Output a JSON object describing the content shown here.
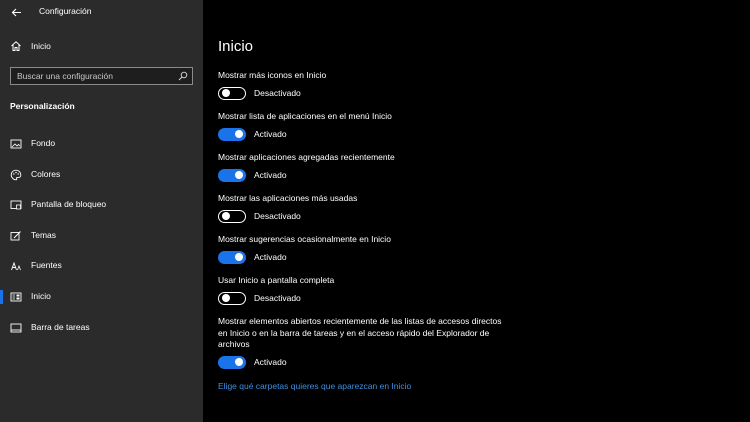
{
  "window": {
    "title": "Configuración"
  },
  "sidebar": {
    "home_label": "Inicio",
    "search": {
      "placeholder": "Buscar una configuración"
    },
    "section_title": "Personalización",
    "items": [
      {
        "label": "Fondo",
        "icon": "image-icon"
      },
      {
        "label": "Colores",
        "icon": "palette-icon"
      },
      {
        "label": "Pantalla de bloqueo",
        "icon": "lock-screen-icon"
      },
      {
        "label": "Temas",
        "icon": "brush-icon"
      },
      {
        "label": "Fuentes",
        "icon": "font-icon"
      },
      {
        "label": "Inicio",
        "icon": "start-menu-icon",
        "selected": true
      },
      {
        "label": "Barra de tareas",
        "icon": "taskbar-icon"
      }
    ]
  },
  "main": {
    "title": "Inicio",
    "settings": [
      {
        "label": "Mostrar más iconos en Inicio",
        "state": "Desactivado",
        "on": false
      },
      {
        "label": "Mostrar lista de aplicaciones en el menú Inicio",
        "state": "Activado",
        "on": true
      },
      {
        "label": "Mostrar aplicaciones agregadas recientemente",
        "state": "Activado",
        "on": true
      },
      {
        "label": "Mostrar las aplicaciones más usadas",
        "state": "Desactivado",
        "on": false
      },
      {
        "label": "Mostrar sugerencias ocasionalmente en Inicio",
        "state": "Activado",
        "on": true
      },
      {
        "label": "Usar Inicio a pantalla completa",
        "state": "Desactivado",
        "on": false
      },
      {
        "label": "Mostrar elementos abiertos recientemente de las listas de accesos directos en Inicio o en la barra de tareas y en el acceso rápido del Explorador de archivos",
        "state": "Activado",
        "on": true
      }
    ],
    "link": "Elige qué carpetas quieres que aparezcan en Inicio"
  },
  "colors": {
    "accent": "#1a73e8",
    "sidebar_bg": "#2b2b2b",
    "main_bg": "#000000",
    "link": "#3d8fe0"
  }
}
